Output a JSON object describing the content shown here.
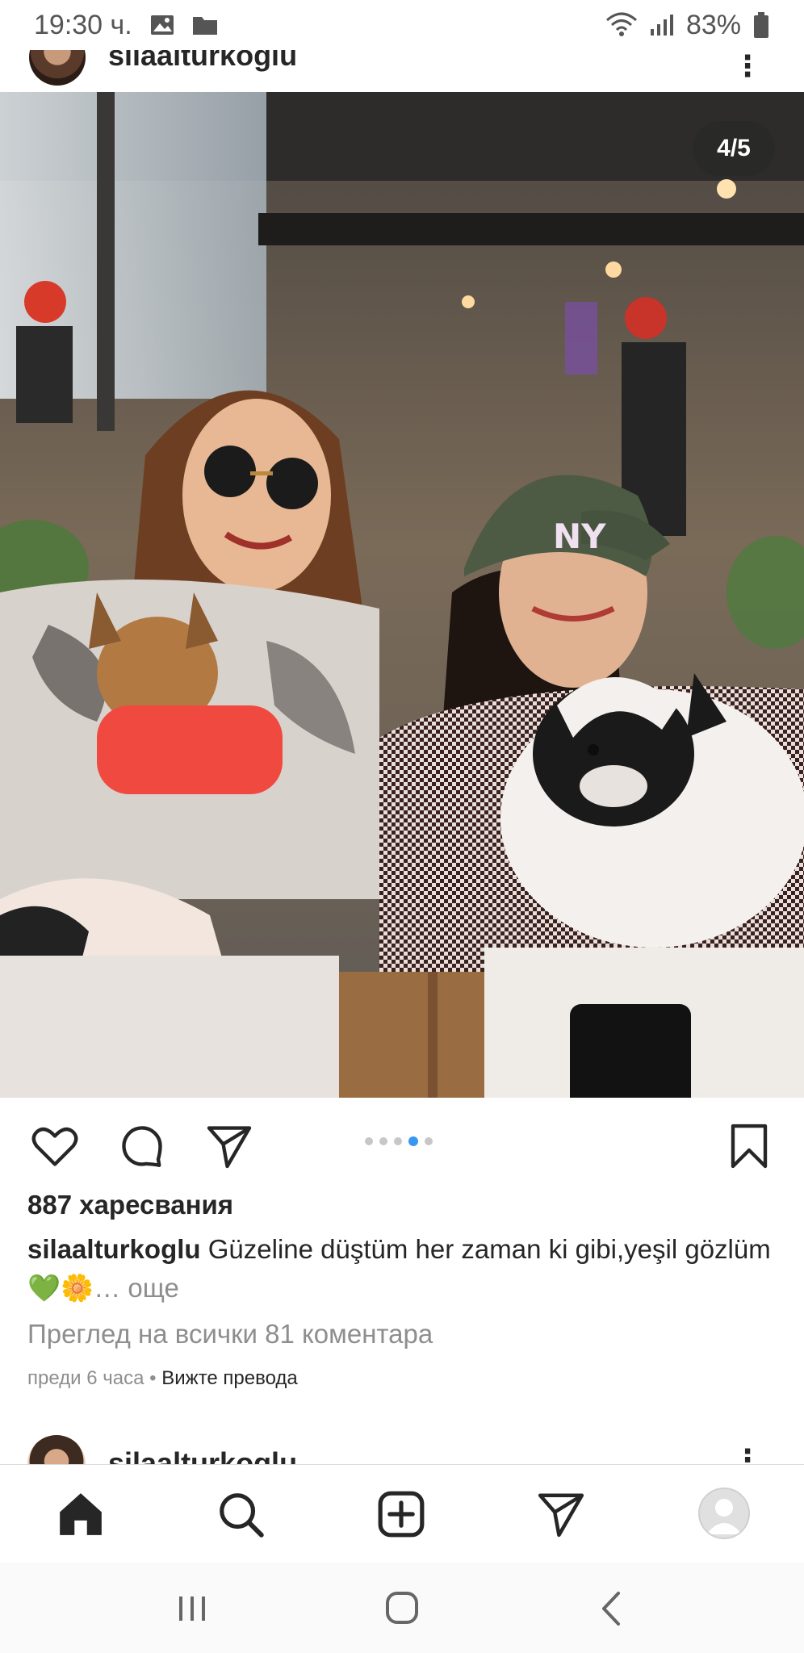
{
  "status_bar": {
    "time": "19:30 ч.",
    "battery": "83%",
    "icons": [
      "image-icon",
      "folder-icon",
      "wifi-icon",
      "signal-icon",
      "battery-icon"
    ]
  },
  "post": {
    "username": "silaalturkoglu",
    "image_counter": "4/5",
    "carousel": {
      "total": 5,
      "active_index": 3
    },
    "likes": "887 харесвания",
    "caption_user": "silaalturkoglu",
    "caption_text": "Güzeline düştüm her zaman ki gibi,yeşil gözlüm💚🌼",
    "caption_more": "… още",
    "comments_link": "Преглед на всички 81 коментара",
    "time_ago": "преди 6 часа",
    "separator": " • ",
    "translate_link": "Вижте превода"
  },
  "next_post": {
    "username": "silaalturkoglu"
  },
  "bottom_nav": {
    "items": [
      "home-icon",
      "search-icon",
      "new-post-icon",
      "direct-icon",
      "profile-avatar"
    ]
  },
  "colors": {
    "accent_blue": "#3897f0",
    "text_primary": "#262626",
    "text_secondary": "#8e8e8e"
  }
}
